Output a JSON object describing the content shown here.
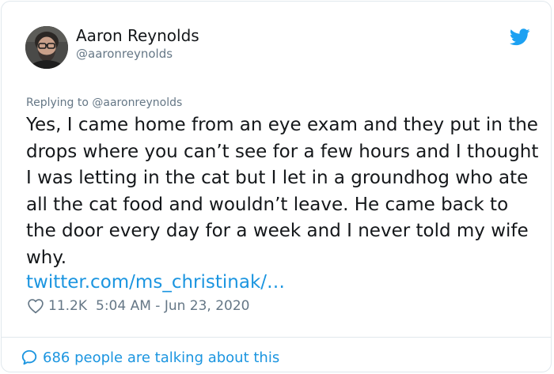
{
  "author": {
    "display_name": "Aaron Reynolds",
    "handle": "@aaronreynolds",
    "avatar_icon": "person-avatar"
  },
  "reply": {
    "prefix": "Replying to ",
    "mention": "@aaronreynolds"
  },
  "tweet": {
    "text": "Yes, I came home from an eye exam and they put in the drops where you can’t see for a few hours and I thought I was letting in the cat but I let in a groundhog who ate all the cat food and wouldn’t leave. He came back to the door every day for a week and I never told my wife why.",
    "link": "twitter.com/ms_christinak/…"
  },
  "meta": {
    "likes": "11.2K",
    "timestamp": "5:04 AM - Jun 23, 2020"
  },
  "footer": {
    "talking": "686 people are talking about this"
  },
  "colors": {
    "brand": "#1da1f2",
    "link": "#1b95e0",
    "secondary_text": "#657786",
    "border": "#e1e8ed"
  },
  "icons": {
    "logo": "twitter-bird-icon",
    "like": "heart-icon",
    "conversation": "speech-bubble-icon"
  }
}
